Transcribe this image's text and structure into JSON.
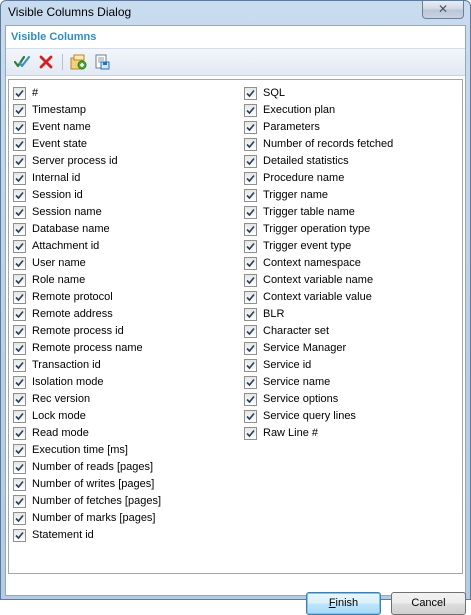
{
  "window": {
    "title": "Visible Columns Dialog",
    "close_glyph": "✕"
  },
  "header": {
    "title": "Visible Columns"
  },
  "toolbar": {
    "buttons": [
      {
        "name": "check-all-icon",
        "color": "#2e7d2e"
      },
      {
        "name": "uncheck-all-icon",
        "color": "#d32020"
      },
      {
        "name": "import-icon",
        "color": "#d99a1e"
      },
      {
        "name": "export-icon",
        "color": "#2c6fbe"
      }
    ]
  },
  "columns": {
    "left": [
      {
        "label": "#",
        "checked": true
      },
      {
        "label": "Timestamp",
        "checked": true
      },
      {
        "label": "Event name",
        "checked": true
      },
      {
        "label": "Event state",
        "checked": true
      },
      {
        "label": "Server process id",
        "checked": true
      },
      {
        "label": "Internal id",
        "checked": true
      },
      {
        "label": "Session id",
        "checked": true
      },
      {
        "label": "Session name",
        "checked": true
      },
      {
        "label": "Database name",
        "checked": true
      },
      {
        "label": "Attachment id",
        "checked": true
      },
      {
        "label": "User name",
        "checked": true
      },
      {
        "label": "Role name",
        "checked": true
      },
      {
        "label": "Remote protocol",
        "checked": true
      },
      {
        "label": "Remote address",
        "checked": true
      },
      {
        "label": "Remote process id",
        "checked": true
      },
      {
        "label": "Remote process name",
        "checked": true
      },
      {
        "label": "Transaction id",
        "checked": true
      },
      {
        "label": "Isolation mode",
        "checked": true
      },
      {
        "label": "Rec version",
        "checked": true
      },
      {
        "label": "Lock mode",
        "checked": true
      },
      {
        "label": "Read mode",
        "checked": true
      },
      {
        "label": "Execution time [ms]",
        "checked": true
      },
      {
        "label": "Number of reads [pages]",
        "checked": true
      },
      {
        "label": "Number of writes [pages]",
        "checked": true
      },
      {
        "label": "Number of fetches [pages]",
        "checked": true
      },
      {
        "label": "Number of marks [pages]",
        "checked": true
      },
      {
        "label": "Statement id",
        "checked": true
      }
    ],
    "right": [
      {
        "label": "SQL",
        "checked": true
      },
      {
        "label": "Execution plan",
        "checked": true
      },
      {
        "label": "Parameters",
        "checked": true
      },
      {
        "label": "Number of records fetched",
        "checked": true
      },
      {
        "label": "Detailed statistics",
        "checked": true
      },
      {
        "label": "Procedure name",
        "checked": true
      },
      {
        "label": "Trigger name",
        "checked": true
      },
      {
        "label": "Trigger table name",
        "checked": true
      },
      {
        "label": "Trigger operation type",
        "checked": true
      },
      {
        "label": "Trigger event type",
        "checked": true
      },
      {
        "label": "Context namespace",
        "checked": true
      },
      {
        "label": "Context variable name",
        "checked": true
      },
      {
        "label": "Context variable value",
        "checked": true
      },
      {
        "label": "BLR",
        "checked": true
      },
      {
        "label": "Character set",
        "checked": true
      },
      {
        "label": "Service Manager",
        "checked": true
      },
      {
        "label": "Service id",
        "checked": true
      },
      {
        "label": "Service name",
        "checked": true
      },
      {
        "label": "Service options",
        "checked": true
      },
      {
        "label": "Service query lines",
        "checked": true
      },
      {
        "label": "Raw Line #",
        "checked": true
      }
    ]
  },
  "buttons": {
    "finish": {
      "mnemonic": "F",
      "rest": "inish"
    },
    "cancel": "Cancel"
  }
}
